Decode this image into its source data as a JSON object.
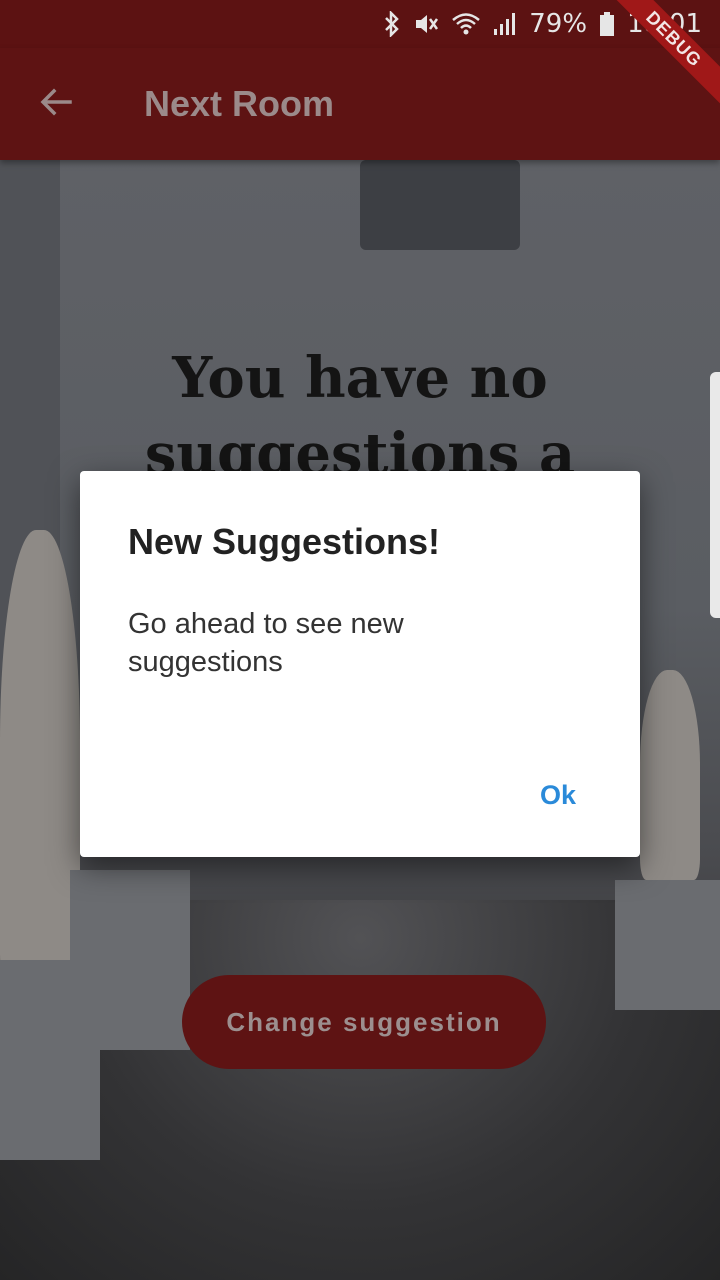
{
  "status_bar": {
    "battery": "79%",
    "time": "18:01",
    "icons": [
      "bluetooth-icon",
      "mute-icon",
      "wifi-icon",
      "signal-icon",
      "battery-icon"
    ]
  },
  "debug_banner": "DEBUG",
  "app_bar": {
    "title": "Next Room",
    "back_icon": "arrow-left-icon"
  },
  "background": {
    "heading": "You have no suggestions a"
  },
  "main": {
    "change_button": "Change suggestion"
  },
  "dialog": {
    "title": "New Suggestions!",
    "body": "Go ahead to see new suggestions",
    "ok": "Ok"
  },
  "colors": {
    "primary": "#5e1313",
    "accent": "#2a8ad9"
  }
}
